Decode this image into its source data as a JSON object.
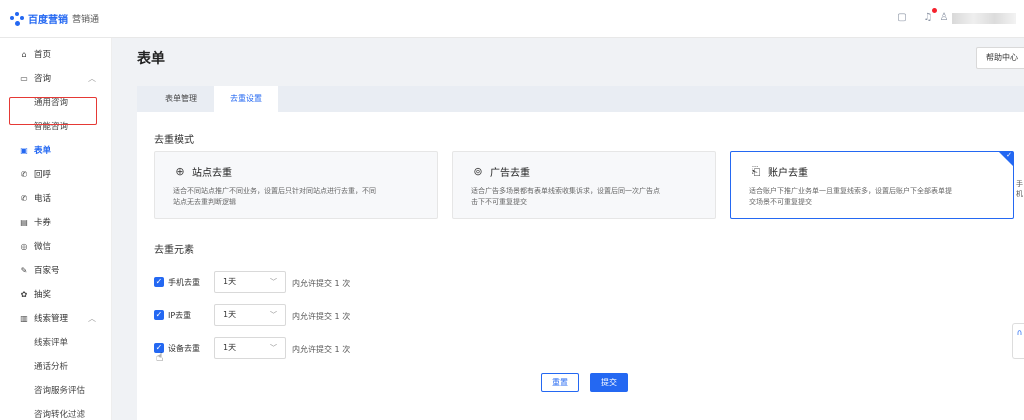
{
  "header": {
    "logo_main": "百度营销",
    "logo_sub": "营销通",
    "icons": [
      "clipboard-icon",
      "bell-icon",
      "user-icon"
    ]
  },
  "sidebar": {
    "items": [
      {
        "label": "首页",
        "icon": "home-icon"
      },
      {
        "label": "咨询",
        "icon": "chat-icon",
        "expanded": true
      },
      {
        "label": "通用咨询",
        "sub": true
      },
      {
        "label": "智能咨询",
        "sub": true
      },
      {
        "label": "表单",
        "icon": "form-icon",
        "active": true
      },
      {
        "label": "回呼",
        "icon": "callback-icon"
      },
      {
        "label": "电话",
        "icon": "phone-icon"
      },
      {
        "label": "卡券",
        "icon": "coupon-icon"
      },
      {
        "label": "微信",
        "icon": "wechat-icon"
      },
      {
        "label": "百家号",
        "icon": "baijiahao-icon"
      },
      {
        "label": "抽奖",
        "icon": "gift-icon"
      },
      {
        "label": "线索管理",
        "icon": "chart-icon",
        "expanded": true
      },
      {
        "label": "线索评单",
        "sub": true
      },
      {
        "label": "通话分析",
        "sub": true
      },
      {
        "label": "咨询服务评估",
        "sub": true
      },
      {
        "label": "咨询转化过滤",
        "sub": true
      }
    ]
  },
  "page": {
    "title": "表单",
    "help_label": "帮助中心",
    "tabs": [
      {
        "label": "表单管理",
        "active": false
      },
      {
        "label": "去重设置",
        "active": true
      }
    ]
  },
  "dedup_mode": {
    "title": "去重模式",
    "cards": [
      {
        "title": "站点去重",
        "icon": "site-icon",
        "desc_line1": "适合不同站点推广不同业务，设置后只针对同站点进行去重，不同",
        "desc_line2": "站点无去重判断逻辑",
        "selected": false
      },
      {
        "title": "广告去重",
        "icon": "ad-icon",
        "desc_line1": "适合广告多场景都有表单线索收集诉求，设置后同一次广告点",
        "desc_line2": "击下不可重复提交",
        "selected": false
      },
      {
        "title": "账户去重",
        "icon": "account-icon",
        "desc_line1": "适合账户下推广业务单一且重复线索多，设置后账户下全部表单提",
        "desc_line2": "交场景不可重复提交",
        "selected": true
      }
    ],
    "overflow_text": "手机"
  },
  "dedup_elements": {
    "title": "去重元素",
    "rows": [
      {
        "label": "手机去重",
        "checked": true,
        "period": "1天",
        "allow_text": "内允许提交",
        "count": "1",
        "unit": "次"
      },
      {
        "label": "IP去重",
        "checked": true,
        "period": "1天",
        "allow_text": "内允许提交",
        "count": "1",
        "unit": "次"
      },
      {
        "label": "设备去重",
        "checked": true,
        "period": "1天",
        "allow_text": "内允许提交",
        "count": "1",
        "unit": "次"
      }
    ]
  },
  "actions": {
    "reset_label": "重置",
    "submit_label": "提交"
  },
  "colors": {
    "accent": "#2468f2",
    "highlight": "#e53935"
  }
}
